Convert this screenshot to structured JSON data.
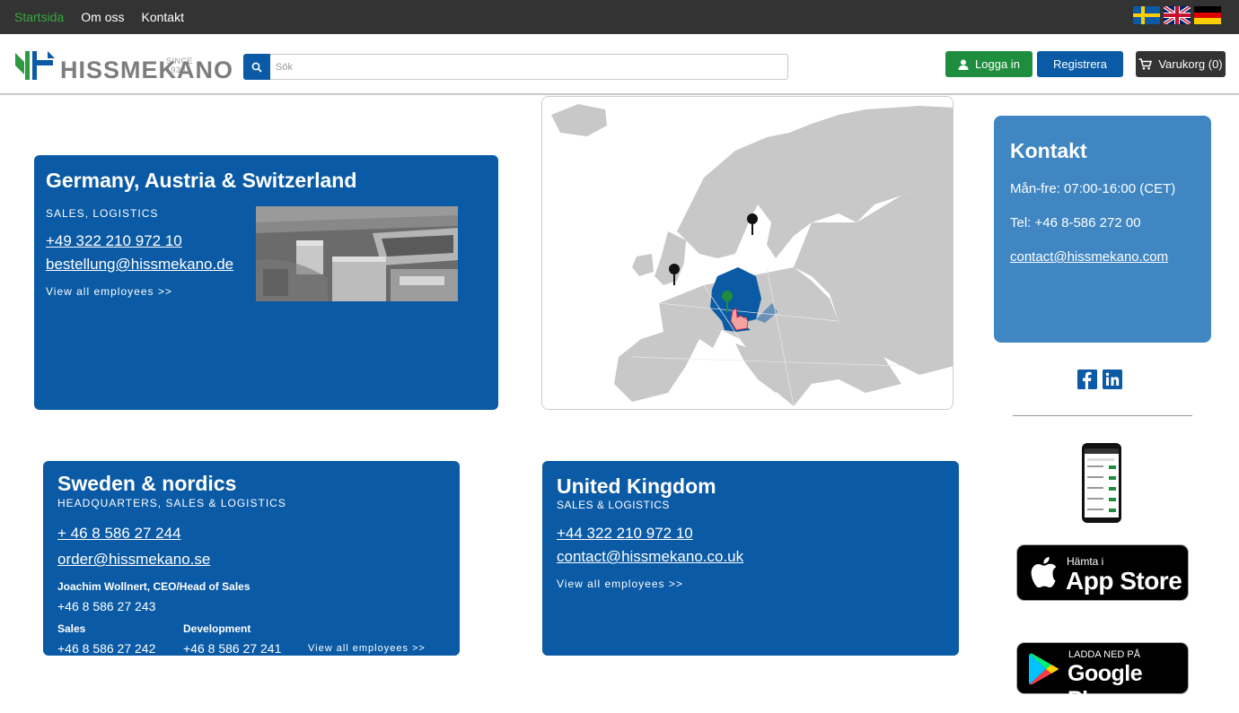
{
  "topnav": {
    "items": [
      {
        "label": "Startsida",
        "active": true
      },
      {
        "label": "Om oss",
        "active": false
      },
      {
        "label": "Kontakt",
        "active": false
      }
    ],
    "flags": [
      "sweden-flag",
      "uk-flag",
      "germany-flag"
    ]
  },
  "header": {
    "logo_text": "HISSMEKANO",
    "logo_since": "SINCE 1938",
    "search_placeholder": "Sök",
    "login_label": "Logga in",
    "register_label": "Registrera",
    "cart_label": "Varukorg (0)"
  },
  "cards": {
    "germany": {
      "title": "Germany, Austria & Switzerland",
      "tag": "SALES, LOGISTICS",
      "phone": "+49 322 210 972 10",
      "email": "bestellung@hissmekano.de",
      "employees_link": "View all employees >>"
    },
    "sweden": {
      "title": "Sweden & nordics",
      "tag": "HEADQUARTERS, SALES & LOGISTICS",
      "phone": "+ 46 8 586 27 244",
      "email": "order@hissmekano.se",
      "ceo_name": "Joachim Wollnert, CEO/Head of Sales",
      "ceo_phone": "+46 8 586 27 243",
      "sales_heading": "Sales",
      "sales_phone": "+46 8 586 27 242",
      "dev_heading": "Development",
      "dev_phone": "+46 8 586 27 241",
      "employees_link": "View all employees >>"
    },
    "uk": {
      "title": "United Kingdom",
      "tag": "SALES & LOGISTICS",
      "phone": "+44 322 210 972 10",
      "email": "contact@hissmekano.co.uk",
      "employees_link": "View all employees >>"
    }
  },
  "sidebar": {
    "contact_title": "Kontakt",
    "hours": "Mån-fre: 07:00-16:00 (CET)",
    "tel": "Tel: +46 8-586 272 00",
    "email": "contact@hissmekano.com",
    "social": [
      "facebook-icon",
      "linkedin-icon"
    ],
    "app_store_small": "Hämta i",
    "app_store_big": "App Store",
    "google_small": "LADDA NED PÅ",
    "google_big": "Google Play"
  },
  "colors": {
    "brand_blue": "#0a5aa5",
    "contact_blue": "#3f86c3",
    "login_green": "#1e8e3e",
    "topbar": "#333333",
    "active_nav": "#3aa63f"
  }
}
